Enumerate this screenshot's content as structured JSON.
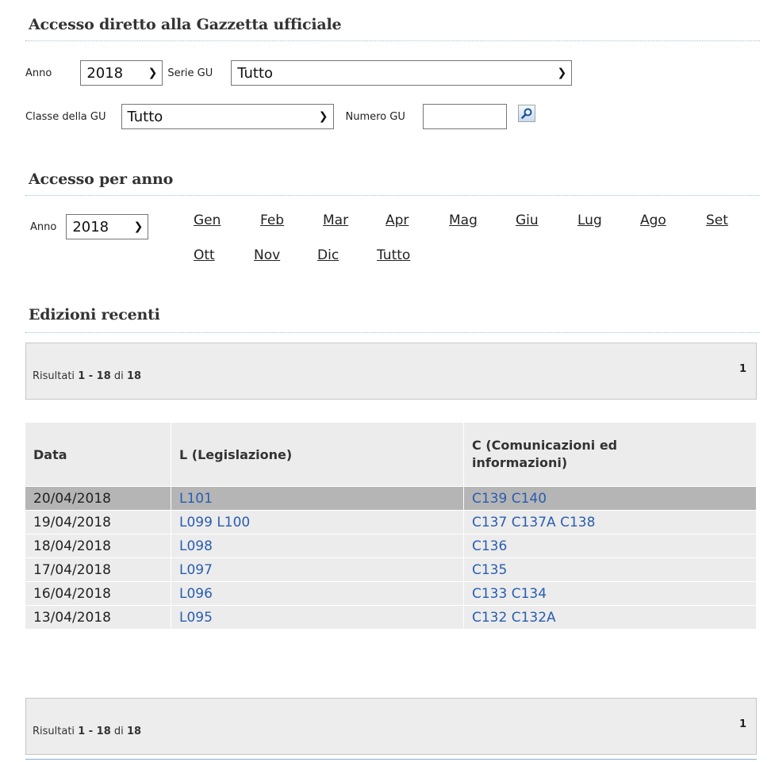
{
  "section1": {
    "title": "Accesso diretto alla Gazzetta ufficiale",
    "anno_label": "Anno",
    "anno_value": "2018",
    "serie_label": "Serie GU",
    "serie_value": "Tutto",
    "classe_label": "Classe della GU",
    "classe_value": "Tutto",
    "numero_label": "Numero GU",
    "numero_value": "",
    "search_icon": "search-icon"
  },
  "section2": {
    "title": "Accesso per anno",
    "anno_label": "Anno",
    "anno_value": "2018",
    "months": [
      "Gen",
      "Feb",
      "Mar",
      "Apr",
      "Mag",
      "Giu",
      "Lug",
      "Ago",
      "Set",
      "Ott",
      "Nov",
      "Dic",
      "Tutto"
    ]
  },
  "section3": {
    "title": "Edizioni recenti",
    "pager_top": {
      "prefix": "Risultati",
      "range": "1 - 18",
      "of": "di",
      "total": "18",
      "page": "1"
    },
    "pager_bottom": {
      "prefix": "Risultati",
      "range": "1 - 18",
      "of": "di",
      "total": "18",
      "page": "1"
    },
    "columns": [
      "Data",
      "L (Legislazione)",
      "C (Comunicazioni ed informazioni)"
    ],
    "rows": [
      {
        "date": "20/04/2018",
        "l": "L101",
        "c": "C139 C140"
      },
      {
        "date": "19/04/2018",
        "l": "L099 L100",
        "c": "C137 C137A C138"
      },
      {
        "date": "18/04/2018",
        "l": "L098",
        "c": "C136"
      },
      {
        "date": "17/04/2018",
        "l": "L097",
        "c": "C135"
      },
      {
        "date": "16/04/2018",
        "l": "L096",
        "c": "C133 C134"
      },
      {
        "date": "13/04/2018",
        "l": "L095",
        "c": "C132 C132A"
      }
    ]
  },
  "colors": {
    "link": "#2a5db0",
    "highlight_row": "#b5b5b5",
    "row_bg": "#ececec",
    "rule": "#9ac3dc"
  }
}
